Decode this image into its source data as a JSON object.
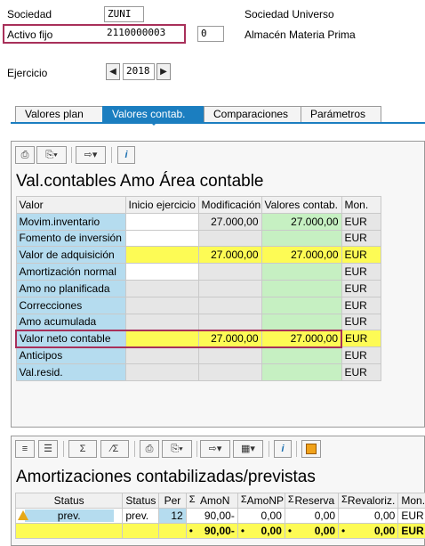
{
  "header": {
    "sociedad_label": "Sociedad",
    "sociedad_value": "ZUNI",
    "sociedad_desc": "Sociedad Universo",
    "activo_label": "Activo fijo",
    "activo_value": "2110000003",
    "subnumber": "0",
    "activo_desc": "Almacén Materia Prima",
    "ejercicio_label": "Ejercicio",
    "ejercicio_value": "2018",
    "prev_icon": "triangle-left-icon",
    "next_icon": "triangle-right-icon"
  },
  "tabs": [
    {
      "label": "Valores plan",
      "active": false
    },
    {
      "label": "Valores contab.",
      "active": true
    },
    {
      "label": "Comparaciones",
      "active": false
    },
    {
      "label": "Parámetros",
      "active": false
    }
  ],
  "panel1": {
    "title": "Val.contables Amo Área contable",
    "columns": [
      "Valor",
      "Inicio ejercicio",
      "Modificación",
      "Valores contab.",
      "Mon."
    ],
    "rows": [
      {
        "valor": "Movim.inventario",
        "inicio": "",
        "mod": "27.000,00",
        "contab": "27.000,00",
        "mon": "EUR",
        "highlight": false
      },
      {
        "valor": "Fomento de inversión",
        "inicio": "",
        "mod": "",
        "contab": "",
        "mon": "EUR",
        "highlight": false
      },
      {
        "valor": "Valor de adquisición",
        "inicio": "",
        "mod": "27.000,00",
        "contab": "27.000,00",
        "mon": "EUR",
        "highlight": true
      },
      {
        "valor": "Amortización normal",
        "inicio": "",
        "mod": "",
        "contab": "",
        "mon": "EUR",
        "highlight": false
      },
      {
        "valor": "Amo no planificada",
        "inicio": "",
        "mod": "",
        "contab": "",
        "mon": "EUR",
        "highlight": false
      },
      {
        "valor": "Correcciones",
        "inicio": "",
        "mod": "",
        "contab": "",
        "mon": "EUR",
        "highlight": false
      },
      {
        "valor": "Amo acumulada",
        "inicio": "",
        "mod": "",
        "contab": "",
        "mon": "EUR",
        "highlight": false
      },
      {
        "valor": "Valor neto contable",
        "inicio": "",
        "mod": "27.000,00",
        "contab": "27.000,00",
        "mon": "EUR",
        "highlight": true
      },
      {
        "valor": "Anticipos",
        "inicio": "",
        "mod": "",
        "contab": "",
        "mon": "EUR",
        "highlight": false
      },
      {
        "valor": "Val.resid.",
        "inicio": "",
        "mod": "",
        "contab": "",
        "mon": "EUR",
        "highlight": false
      }
    ],
    "toolbar": {
      "info": "i"
    }
  },
  "panel2": {
    "title": "Amortizaciones contabilizadas/previstas",
    "columns": [
      "Status",
      "Status",
      "Per",
      "AmoN",
      "AmoNP",
      "Reserva",
      "Revaloriz.",
      "Mon."
    ],
    "sigma": "Σ",
    "row": {
      "status_text": "prev.",
      "status2": "prev.",
      "per": "12",
      "amon": "90,00-",
      "amonp": "0,00",
      "reserva": "0,00",
      "revaloriz": "0,00",
      "mon": "EUR"
    },
    "total": {
      "amon": "90,00-",
      "amonp": "0,00",
      "reserva": "0,00",
      "revaloriz": "0,00",
      "mon": "EUR"
    },
    "toolbar": {
      "sum": "Σ",
      "subtotal": "⁄Σ",
      "info": "i"
    }
  }
}
